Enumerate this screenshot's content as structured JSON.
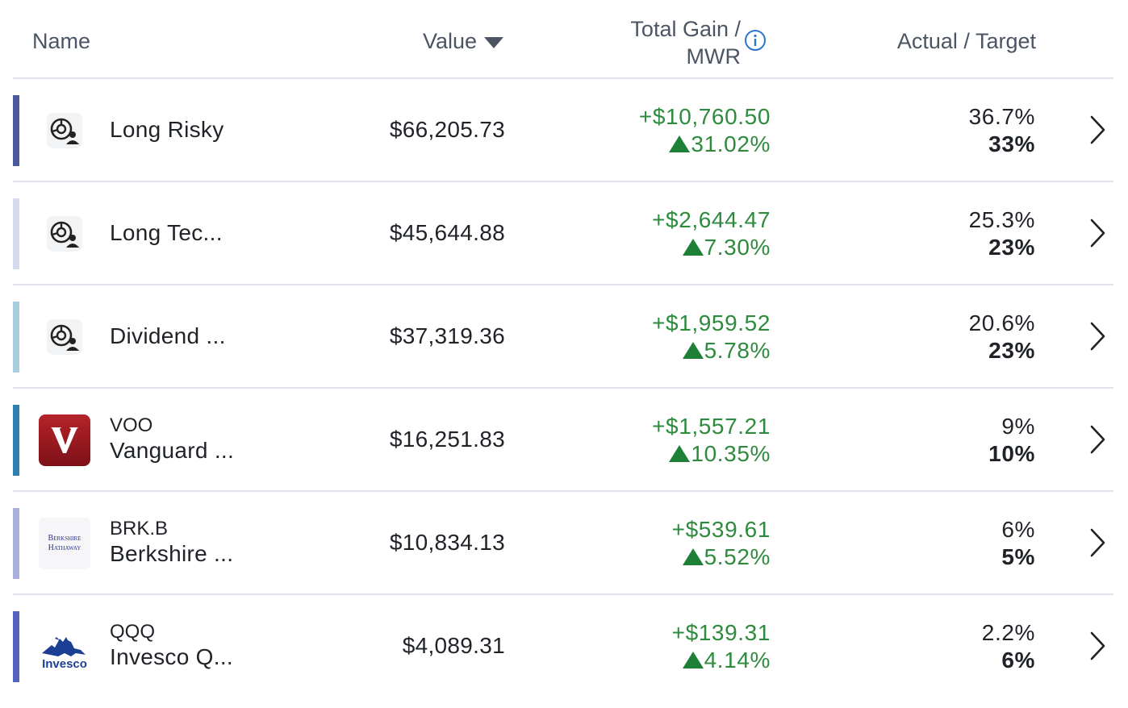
{
  "header": {
    "name": "Name",
    "value": "Value",
    "gain_line1": "Total Gain /",
    "gain_line2": "MWR",
    "actual_target": "Actual / Target"
  },
  "colors": {
    "gain_green": "#2e8b3e",
    "divider": "#dfe3ea",
    "header_text": "#4b5563"
  },
  "rows": [
    {
      "ticker": "",
      "name": "Long Risky",
      "value": "$66,205.73",
      "gain": "+$10,760.50",
      "mwr": "31.02%",
      "actual": "36.7%",
      "target": "33%",
      "accent": "#4a5a9c",
      "logo": "portfolio-person-icon"
    },
    {
      "ticker": "",
      "name": "Long Tec...",
      "value": "$45,644.88",
      "gain": "+$2,644.47",
      "mwr": "7.30%",
      "actual": "25.3%",
      "target": "23%",
      "accent": "#d4dbee",
      "logo": "portfolio-person-icon"
    },
    {
      "ticker": "",
      "name": "Dividend ...",
      "value": "$37,319.36",
      "gain": "+$1,959.52",
      "mwr": "5.78%",
      "actual": "20.6%",
      "target": "23%",
      "accent": "#a9cfdf",
      "logo": "portfolio-person-icon"
    },
    {
      "ticker": "VOO",
      "name": "Vanguard ...",
      "value": "$16,251.83",
      "gain": "+$1,557.21",
      "mwr": "10.35%",
      "actual": "9%",
      "target": "10%",
      "accent": "#2f7fb0",
      "logo": "vanguard-logo"
    },
    {
      "ticker": "BRK.B",
      "name": "Berkshire ...",
      "value": "$10,834.13",
      "gain": "+$539.61",
      "mwr": "5.52%",
      "actual": "6%",
      "target": "5%",
      "accent": "#aab0dc",
      "logo": "berkshire-hathaway-logo",
      "logo_text_1": "Berkshire",
      "logo_text_2": "Hathaway"
    },
    {
      "ticker": "QQQ",
      "name": "Invesco Q...",
      "value": "$4,089.31",
      "gain": "+$139.31",
      "mwr": "4.14%",
      "actual": "2.2%",
      "target": "6%",
      "accent": "#5462c0",
      "logo": "invesco-logo",
      "logo_text_1": "Invesco"
    }
  ]
}
